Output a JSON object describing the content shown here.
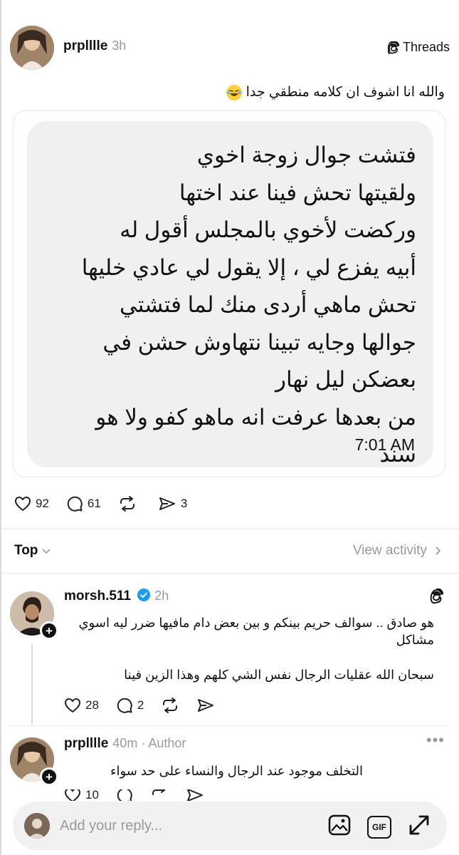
{
  "post": {
    "author": "prplllle",
    "time": "3h",
    "brand": "Threads",
    "caption": "والله انا اشوف ان كلامه منطقي جدا",
    "screenshot": {
      "lines": [
        "فتشت جوال زوجة اخوي",
        "ولقيتها تحش فينا عند اختها",
        "وركضت لأخوي بالمجلس أقول له",
        "أبيه يفزع لي ، إلا يقول لي عادي خليها",
        "تحش ماهي أردى منك لما فتشتي",
        "جوالها وجايه تبينا نتهاوش حشن في",
        "بعضكن ليل نهار",
        "من بعدها عرفت انه ماهو كفو ولا هو",
        "سند"
      ],
      "time": "7:01 AM"
    },
    "stats": {
      "likes": "92",
      "comments": "61",
      "reposts": "",
      "shares": "3"
    }
  },
  "sort": {
    "label": "Top",
    "view_activity": "View activity"
  },
  "replies": [
    {
      "author": "morsh.511",
      "time": "2h",
      "texts": [
        "هو صادق .. سوالف حريم بينكم و بين بعض دام مافيها ضرر ليه اسوي مشاكل",
        "سبحان الله عقليات الرجال نفس الشي كلهم وهذا الزين فينا"
      ],
      "stats": {
        "likes": "28",
        "comments": "2"
      }
    },
    {
      "author": "prplllle",
      "time": "40m",
      "tag": "Author",
      "texts": [
        "التخلف موجود عند الرجال والنساء على حد سواء"
      ],
      "stats": {
        "likes": "10",
        "comments": ""
      }
    }
  ],
  "composer": {
    "placeholder": "Add your reply...",
    "gif_label": "GIF"
  },
  "icons": {
    "like": "heart-icon",
    "comment": "comment-bubble-icon",
    "repost": "repost-icon",
    "share": "send-icon",
    "brand": "threads-logo-icon",
    "verified": "verified-badge-icon",
    "image": "image-icon",
    "gif": "gif-icon",
    "expand": "expand-icon",
    "chevron": "chevron-down-icon"
  },
  "colors": {
    "verified": "#1d9bf0",
    "bubble": "#eef0f2",
    "muted": "#9a9a9a"
  }
}
